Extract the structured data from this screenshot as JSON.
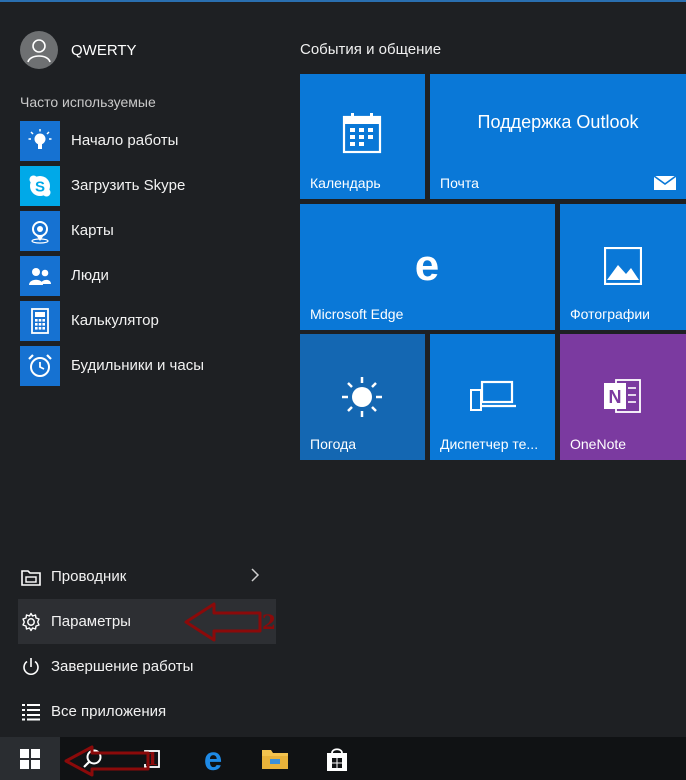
{
  "user": {
    "name": "QWERTY"
  },
  "frequent": {
    "header": "Часто используемые",
    "items": [
      {
        "label": "Начало работы",
        "icon": "lightbulb-icon"
      },
      {
        "label": "Загрузить Skype",
        "icon": "skype-icon"
      },
      {
        "label": "Карты",
        "icon": "maps-icon"
      },
      {
        "label": "Люди",
        "icon": "people-icon"
      },
      {
        "label": "Калькулятор",
        "icon": "calculator-icon"
      },
      {
        "label": "Будильники и часы",
        "icon": "alarm-clock-icon"
      }
    ]
  },
  "bottom": {
    "items": [
      {
        "label": "Проводник",
        "icon": "file-explorer-icon"
      },
      {
        "label": "Параметры",
        "icon": "gear-icon"
      },
      {
        "label": "Завершение работы",
        "icon": "power-icon"
      },
      {
        "label": "Все приложения",
        "icon": "list-icon"
      }
    ]
  },
  "tiles": {
    "group_title": "События и общение",
    "calendar": "Календарь",
    "mail": "Почта",
    "mail_headline": "Поддержка Outlook",
    "edge": "Microsoft Edge",
    "photos": "Фотографии",
    "weather": "Погода",
    "phone": "Диспетчер те...",
    "onenote": "OneNote"
  },
  "annotations": {
    "one": "1",
    "two": "2"
  },
  "colors": {
    "tile_blue": "#0a78d7",
    "weather_blue": "#1467b2",
    "onenote_purple": "#7b3aa0",
    "accent": "#1672d2",
    "annotation_red": "#8b0a0a"
  }
}
